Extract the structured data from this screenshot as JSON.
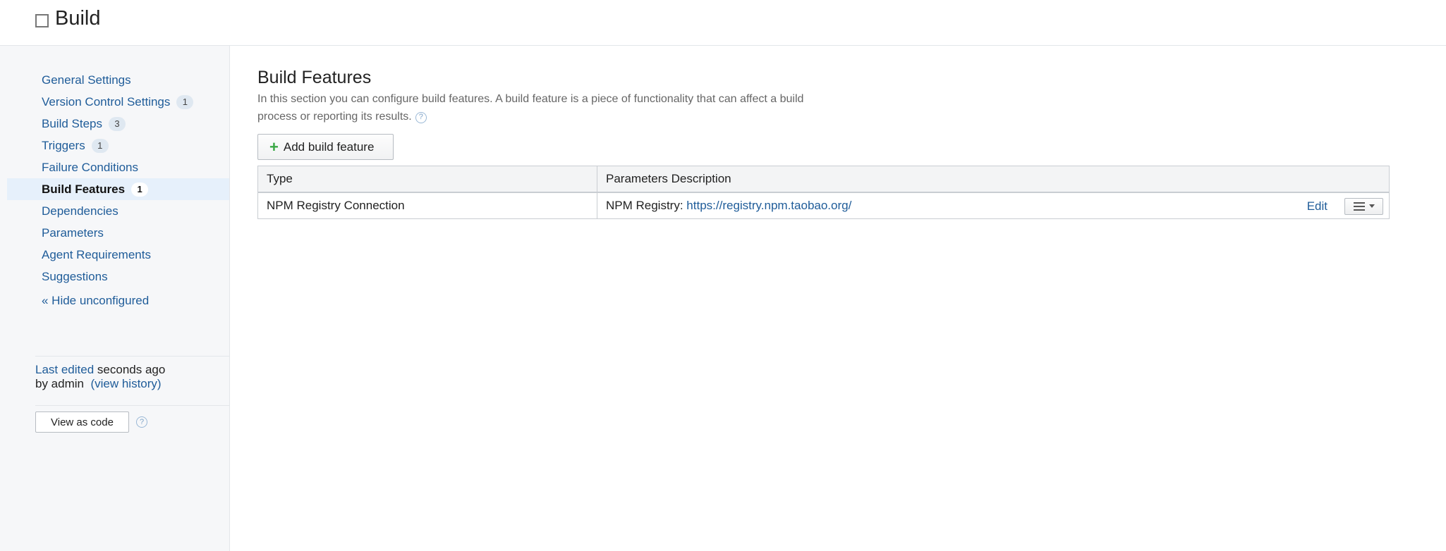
{
  "header": {
    "title": "Build"
  },
  "sidebar": {
    "items": [
      {
        "label": "General Settings",
        "badge": ""
      },
      {
        "label": "Version Control Settings",
        "badge": "1"
      },
      {
        "label": "Build Steps",
        "badge": "3"
      },
      {
        "label": "Triggers",
        "badge": "1"
      },
      {
        "label": "Failure Conditions",
        "badge": ""
      },
      {
        "label": "Build Features",
        "badge": "1",
        "active": true
      },
      {
        "label": "Dependencies",
        "badge": ""
      },
      {
        "label": "Parameters",
        "badge": ""
      },
      {
        "label": "Agent Requirements",
        "badge": ""
      },
      {
        "label": "Suggestions",
        "badge": ""
      }
    ],
    "hide_unconfigured": "« Hide unconfigured",
    "last_edited_link": "Last edited",
    "last_edited_time": "seconds ago",
    "edited_by": "by admin",
    "view_history_open": "(",
    "view_history": "view history",
    "view_history_close": ")",
    "view_as_code": "View as code",
    "help_glyph": "?"
  },
  "main": {
    "title": "Build Features",
    "description": "In this section you can configure build features. A build feature is a piece of functionality that can affect a build process or reporting its results.",
    "help_glyph": "?",
    "add_button_icon": "+",
    "add_button": "Add build feature",
    "table": {
      "headers": [
        "Type",
        "Parameters Description"
      ],
      "rows": [
        {
          "type": "NPM Registry Connection",
          "param_label": "NPM Registry: ",
          "param_link": "https://registry.npm.taobao.org/",
          "edit": "Edit"
        }
      ]
    }
  },
  "colors": {
    "link": "#1f5c99",
    "active_bg": "#e6f0fb",
    "sidebar_bg": "#f6f7f9",
    "plus": "#3aa845"
  },
  "icons": {
    "breadcrumb": "square-icon",
    "add": "plus-icon",
    "help": "help-circle-icon",
    "actions": "list-icon",
    "dropdown": "caret-down-icon"
  }
}
